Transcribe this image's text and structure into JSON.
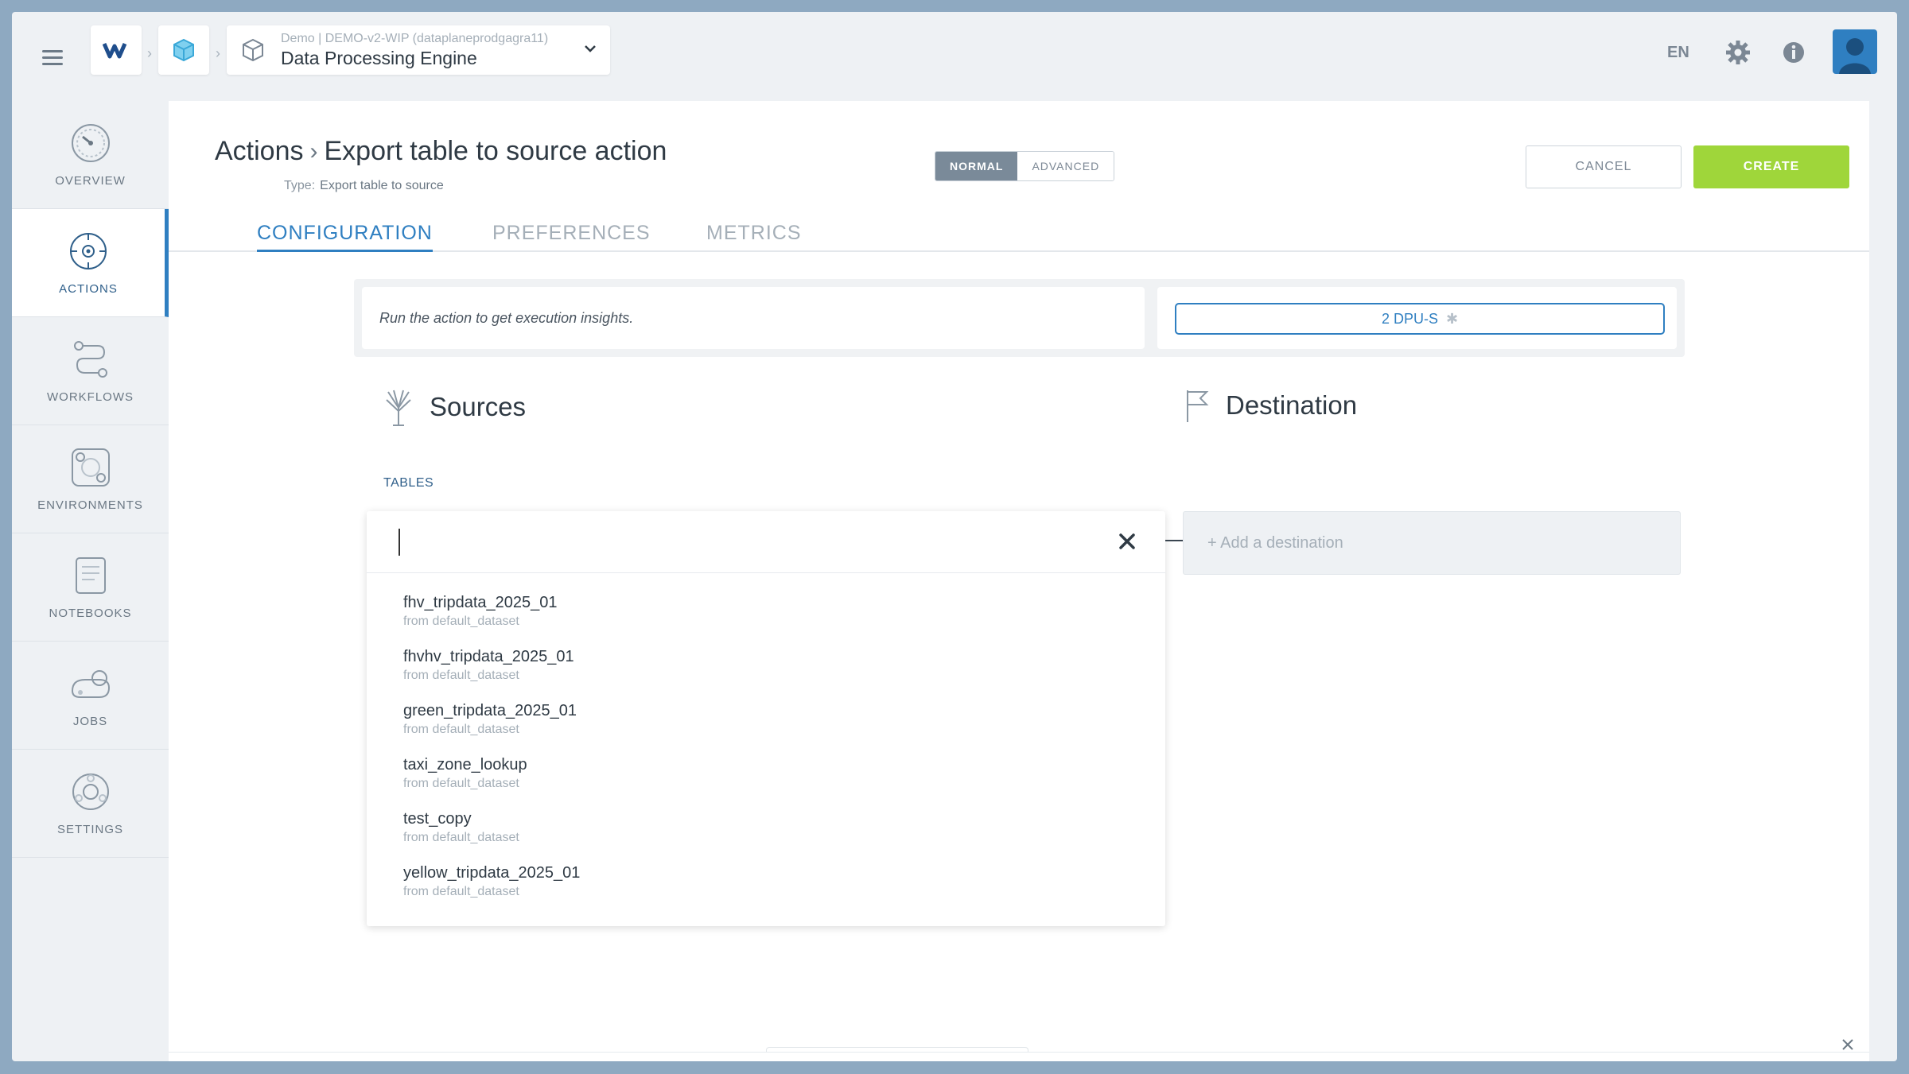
{
  "topbar": {
    "engine_sub": "Demo | DEMO-v2-WIP (dataplaneprodgagra11)",
    "engine_title": "Data Processing Engine",
    "language": "EN"
  },
  "sidebar": {
    "items": [
      {
        "label": "OVERVIEW",
        "icon": "overview-icon"
      },
      {
        "label": "ACTIONS",
        "icon": "actions-icon",
        "active": true
      },
      {
        "label": "WORKFLOWS",
        "icon": "workflows-icon"
      },
      {
        "label": "ENVIRONMENTS",
        "icon": "environments-icon"
      },
      {
        "label": "NOTEBOOKS",
        "icon": "notebooks-icon"
      },
      {
        "label": "JOBS",
        "icon": "jobs-icon"
      },
      {
        "label": "SETTINGS",
        "icon": "settings-icon"
      }
    ]
  },
  "header": {
    "breadcrumb_root": "Actions",
    "title": "Export table to source action",
    "type_label": "Type:",
    "type_value": "Export table to source",
    "mode_normal": "NORMAL",
    "mode_advanced": "ADVANCED",
    "cancel": "CANCEL",
    "create": "CREATE"
  },
  "tabs": [
    "CONFIGURATION",
    "PREFERENCES",
    "METRICS"
  ],
  "insight": {
    "text": "Run the action to get execution insights.",
    "dpu": "2 DPU-S"
  },
  "sources": {
    "title": "Sources",
    "tables_label": "TABLES",
    "search_value": "",
    "options": [
      {
        "name": "fhv_tripdata_2025_01",
        "from": "from default_dataset"
      },
      {
        "name": "fhvhv_tripdata_2025_01",
        "from": "from default_dataset"
      },
      {
        "name": "green_tripdata_2025_01",
        "from": "from default_dataset"
      },
      {
        "name": "taxi_zone_lookup",
        "from": "from default_dataset"
      },
      {
        "name": "test_copy",
        "from": "from default_dataset"
      },
      {
        "name": "yellow_tripdata_2025_01",
        "from": "from default_dataset"
      }
    ]
  },
  "destination": {
    "title": "Destination",
    "add_label": "+ Add a destination"
  },
  "colors": {
    "accent": "#2f7fc1",
    "create": "#9fd63a",
    "frame": "#8ea9c1"
  }
}
